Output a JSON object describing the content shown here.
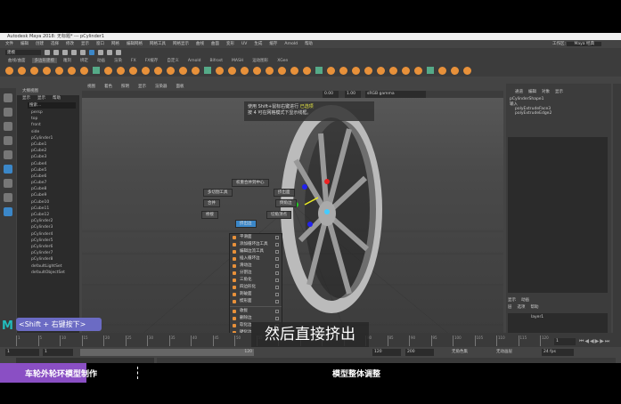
{
  "window": {
    "title": "Autodesk Maya 2018: 无标题* --- pCylinder1"
  },
  "menubar": [
    "文件",
    "编辑",
    "创建",
    "选择",
    "修改",
    "显示",
    "窗口",
    "网格",
    "编辑网格",
    "网格工具",
    "网格显示",
    "曲线",
    "曲面",
    "变形",
    "UV",
    "生成",
    "缓存",
    "Arnold",
    "帮助"
  ],
  "workspace": {
    "label": "工作区:",
    "value": "Maya 经典"
  },
  "mode_select": "建模",
  "shelf_tabs": [
    {
      "label": "曲线/曲面"
    },
    {
      "label": "多边形建模",
      "active": true
    },
    {
      "label": "雕刻"
    },
    {
      "label": "绑定"
    },
    {
      "label": "动画"
    },
    {
      "label": "渲染"
    },
    {
      "label": "FX"
    },
    {
      "label": "FX缓存"
    },
    {
      "label": "自定义"
    },
    {
      "label": "Arnold"
    },
    {
      "label": "Bifrost"
    },
    {
      "label": "MASH"
    },
    {
      "label": "运动图形"
    },
    {
      "label": "XGen"
    }
  ],
  "outliner": {
    "title": "大纲视图",
    "menus": [
      "显示",
      "显示",
      "帮助"
    ],
    "search": "搜索...",
    "items": [
      "persp",
      "top",
      "front",
      "side",
      "pCylinder1",
      "pCube1",
      "pCube2",
      "pCube3",
      "pCube4",
      "pCube5",
      "pCube6",
      "pCube7",
      "pCube8",
      "pCube9",
      "pCube10",
      "pCube11",
      "pCube12",
      "pCylinder2",
      "pCylinder3",
      "pCylinder4",
      "pCylinder5",
      "pCylinder6",
      "pCylinder7",
      "pCylinder8",
      "defaultLightSet",
      "defaultObjectSet"
    ]
  },
  "viewport": {
    "menus": [
      "视图",
      "着色",
      "照明",
      "显示",
      "渲染器",
      "面板"
    ],
    "field1": "0.00",
    "field2": "1.00",
    "colorspace": "sRGB gamma",
    "help": {
      "line1a": "使用 Shift+鼠标右键进行 ",
      "line1b": "已选项",
      "line2": "按 4 可在网格模式下显示线框。"
    }
  },
  "marking_menu": {
    "top": "权重合并到中心",
    "left1": "多切割工具",
    "right1": "挤出面",
    "left2": "合并",
    "right2": "倒角边",
    "left3": "桥接",
    "right3": "切角顶点",
    "center": "挤出边"
  },
  "menu_list": [
    {
      "label": "平滑面"
    },
    {
      "label": "添加循环边工具"
    },
    {
      "label": "编辑边流工具"
    },
    {
      "label": "插入循环边"
    },
    {
      "label": "滑动边"
    },
    {
      "label": "分割边"
    },
    {
      "label": "三角化"
    },
    {
      "label": "四边形化"
    },
    {
      "label": "刺破面"
    },
    {
      "label": "楔形面"
    },
    {
      "sep": true
    },
    {
      "label": "收拢"
    },
    {
      "label": "删除边"
    },
    {
      "label": "软化边"
    },
    {
      "label": "硬化边"
    },
    {
      "label": "平滑工具"
    },
    {
      "label": "从边创建曲线"
    },
    {
      "sep": true
    },
    {
      "label": "挤出"
    },
    {
      "label": "工具选项"
    }
  ],
  "channel_box": {
    "tabs": [
      "通道",
      "编辑",
      "对象",
      "显示"
    ],
    "object": "pCylinderShape1",
    "label": "输入",
    "inputs": [
      "polyExtrudeFace3",
      "polyExtrudeEdge2"
    ],
    "layer_tabs": [
      "显示",
      "动画"
    ],
    "layer_opts": [
      "层",
      "选项",
      "帮助"
    ],
    "layer": "layer1"
  },
  "hint": "<Shift + 右键按下>",
  "subtitle": "然后直接挤出",
  "timeline": {
    "current": "1",
    "ticks": [
      "1",
      "5",
      "10",
      "15",
      "20",
      "25",
      "30",
      "35",
      "40",
      "45",
      "50",
      "55",
      "60",
      "65",
      "70",
      "75",
      "80",
      "85",
      "90",
      "95",
      "100",
      "105",
      "110",
      "115",
      "120"
    ]
  },
  "range": {
    "start": "1",
    "start2": "1",
    "end_slider": "120",
    "end": "120",
    "max": "200",
    "char_set": "无角色集",
    "anim_layer": "无动画层",
    "fps": "24 fps"
  },
  "chapters": {
    "left": "车轮外轮环模型制作",
    "right": "模型整体调整",
    "progress_percent": 45
  },
  "colors": {
    "accent": "#3b87c8",
    "shelf_icon": "#e8913a",
    "hint_bg": "#6b6bc4",
    "chapter": "#8a4fc4"
  }
}
